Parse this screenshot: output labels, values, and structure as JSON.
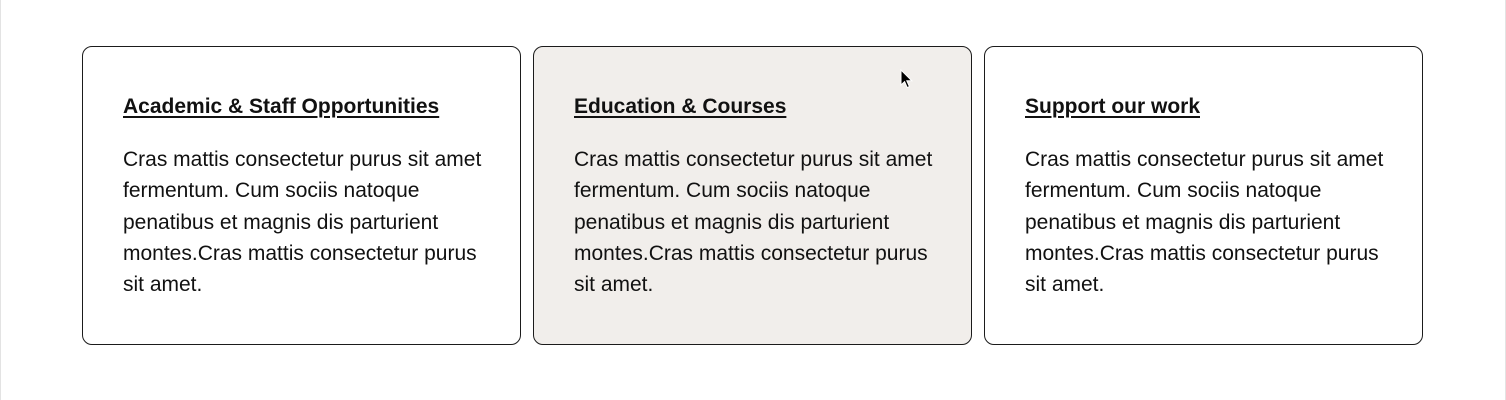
{
  "cards": [
    {
      "title": "Academic & Staff Opportunities",
      "body": "Cras mattis consectetur purus sit amet fermentum. Cum sociis natoque penatibus et magnis dis parturient montes.Cras mattis consectetur purus sit amet."
    },
    {
      "title": "Education & Courses",
      "body": "Cras mattis consectetur purus sit amet fermentum. Cum sociis natoque penatibus et magnis dis parturient montes.Cras mattis consectetur purus sit amet."
    },
    {
      "title": "Support our work",
      "body": "Cras mattis consectetur purus sit amet fermentum. Cum sociis natoque penatibus et magnis dis parturient montes.Cras mattis consectetur purus sit amet."
    }
  ],
  "colors": {
    "card_border": "#1b1b1b",
    "hover_background": "#f1eeeb",
    "text": "#111111"
  },
  "cursor_icon": "arrow-pointer-icon"
}
